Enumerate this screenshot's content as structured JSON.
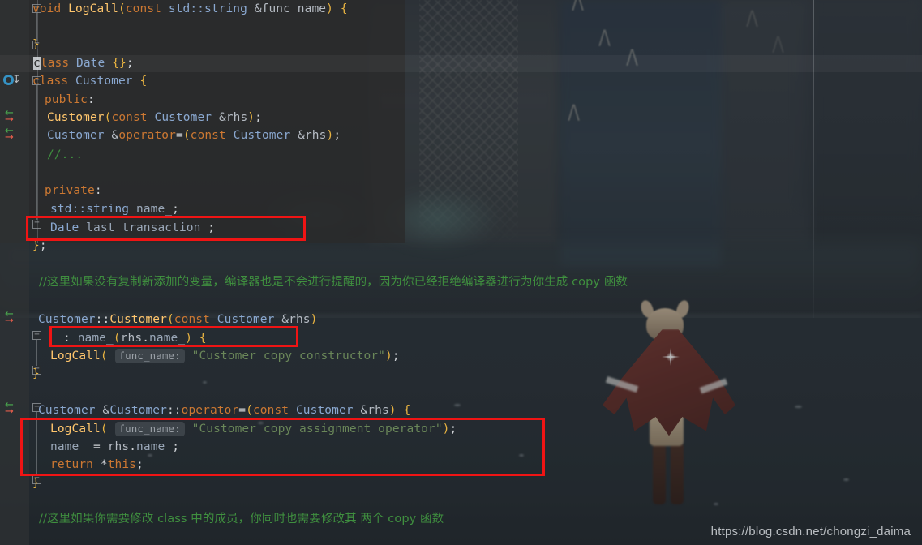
{
  "app": {
    "kind": "code-editor",
    "theme": "darcula-with-background-image"
  },
  "watermark": {
    "text": "https://blog.csdn.net/chongzi_daima"
  },
  "colors": {
    "keyword": "#cc7832",
    "function": "#ffc66d",
    "type": "#8aa8d0",
    "identifier": "#b6bcc4",
    "string": "#6a8759",
    "comment": "#3f8f3f",
    "brace": "#e8b341",
    "annotation_box": "#f01414",
    "gutter_override_green": "#4caf50",
    "gutter_override_red": "#e05c4b",
    "gutter_impl_blue": "#3592c4",
    "editor_background": "#2b2b2b"
  },
  "editor": {
    "inlay_hint_label": "func_name:",
    "lines": [
      {
        "n": 1,
        "text": "void LogCall(const std::string &func_name) {"
      },
      {
        "n": 2,
        "text": ""
      },
      {
        "n": 3,
        "text": "}"
      },
      {
        "n": 4,
        "text": "class Date {};"
      },
      {
        "n": 5,
        "text": "class Customer {"
      },
      {
        "n": 6,
        "text": "  public:"
      },
      {
        "n": 7,
        "text": "    Customer(const Customer &rhs);"
      },
      {
        "n": 8,
        "text": "    Customer &operator=(const Customer &rhs);"
      },
      {
        "n": 9,
        "text": "    //..."
      },
      {
        "n": 10,
        "text": ""
      },
      {
        "n": 11,
        "text": "  private:"
      },
      {
        "n": 12,
        "text": "    std::string name_;"
      },
      {
        "n": 13,
        "text": "    Date last_transaction_;"
      },
      {
        "n": 14,
        "text": "};"
      },
      {
        "n": 15,
        "text": ""
      },
      {
        "n": 16,
        "text": "//这里如果没有复制新添加的变量，编译器也是不会进行提醒的，因为你已经拒绝编译器进行为你生成 copy 函数"
      },
      {
        "n": 17,
        "text": ""
      },
      {
        "n": 18,
        "text": "Customer::Customer(const Customer &rhs)"
      },
      {
        "n": 19,
        "text": "    : name_(rhs.name_) {"
      },
      {
        "n": 20,
        "text": "  LogCall( func_name: \"Customer copy constructor\");"
      },
      {
        "n": 21,
        "text": "}"
      },
      {
        "n": 22,
        "text": ""
      },
      {
        "n": 23,
        "text": "Customer &Customer::operator=(const Customer &rhs) {"
      },
      {
        "n": 24,
        "text": "    LogCall( func_name: \"Customer copy assignment operator\");"
      },
      {
        "n": 25,
        "text": "    name_ = rhs.name_;"
      },
      {
        "n": 26,
        "text": "    return *this;"
      },
      {
        "n": 27,
        "text": "}"
      },
      {
        "n": 28,
        "text": ""
      },
      {
        "n": 29,
        "text": "//这里如果你需要修改 class 中的成员，你同时也需要修改其 两个 copy 函数"
      }
    ],
    "caret": {
      "line": 4,
      "column": 1,
      "char": "c"
    }
  },
  "comments": {
    "first": "//这里如果没有复制新添加的变量，编译器也是不会进行提醒的，因为你已经拒绝编译器进行为你生成 copy 函数",
    "second": "//这里如果你需要修改 class 中的成员，你同时也需要修改其 两个 copy 函数"
  },
  "annotations": [
    {
      "id": "box-date-member",
      "highlights_line": 13
    },
    {
      "id": "box-init-list",
      "highlights_line": 19
    },
    {
      "id": "box-assignment-body",
      "highlights_lines": [
        24,
        25,
        26
      ]
    }
  ],
  "gutter_icons": [
    {
      "name": "implemented-method-icon",
      "line": 5,
      "glyph": "O"
    },
    {
      "name": "overriding-method-icon",
      "line": 7
    },
    {
      "name": "overriding-method-icon",
      "line": 8
    },
    {
      "name": "overriding-method-icon",
      "line": 18
    },
    {
      "name": "overriding-method-icon",
      "line": 23
    }
  ]
}
